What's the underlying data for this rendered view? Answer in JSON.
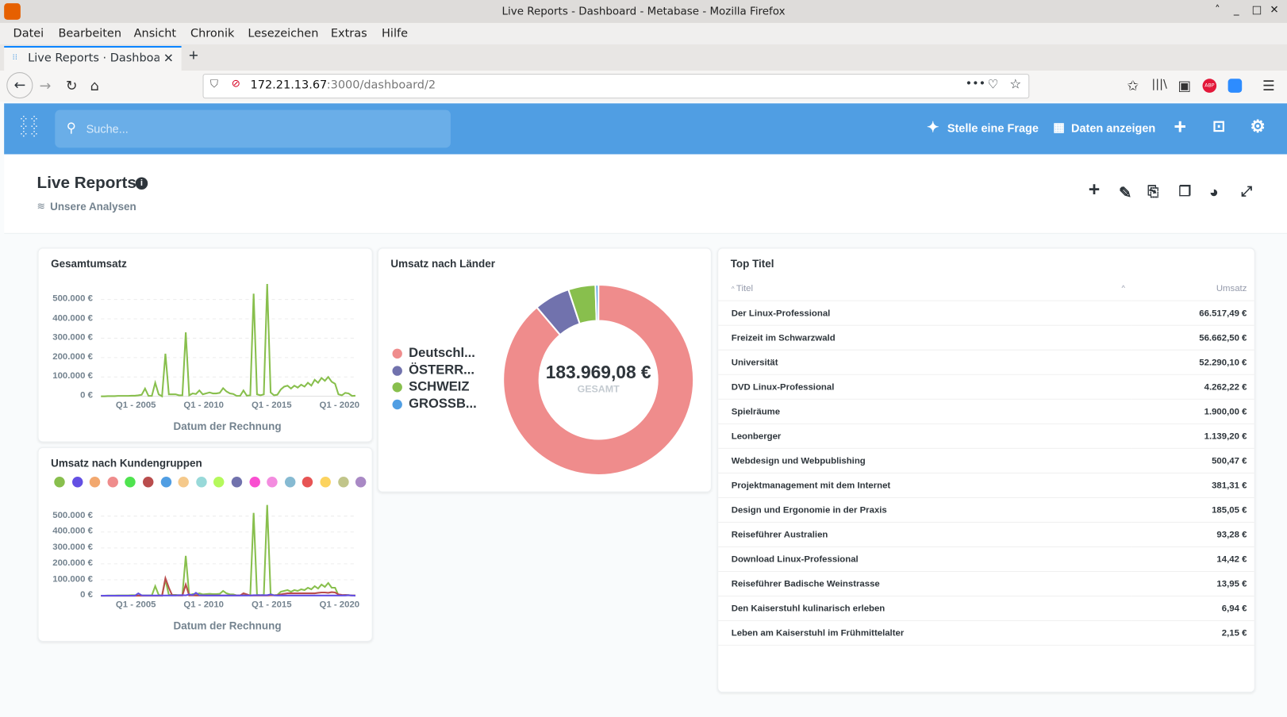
{
  "window": {
    "title": "Live Reports - Dashboard - Metabase - Mozilla Firefox"
  },
  "menu": [
    "Datei",
    "Bearbeiten",
    "Ansicht",
    "Chronik",
    "Lesezeichen",
    "Extras",
    "Hilfe"
  ],
  "tab": {
    "label": "Live Reports · Dashboard"
  },
  "url": {
    "host": "172.21.13.67",
    "path": ":3000/dashboard/2"
  },
  "nav": {
    "search_placeholder": "Suche...",
    "ask": "Stelle eine Frage",
    "browse": "Daten anzeigen",
    "accent": "#509ee3"
  },
  "dashboard": {
    "title": "Live Reports",
    "collection": "Unsere Analysen"
  },
  "chart_data": [
    {
      "type": "line",
      "title": "Gesamtumsatz",
      "xlabel": "Datum der Rechnung",
      "ylabel": "",
      "x_start": "Q1 - 2002",
      "x_end": "Q4 - 2020",
      "x_ticks": [
        "Q1 - 2005",
        "Q1 - 2010",
        "Q1 - 2015",
        "Q1 - 2020"
      ],
      "y_ticks": [
        "500.000 €",
        "400.000 €",
        "300.000 €",
        "200.000 €",
        "100.000 €",
        "0 €"
      ],
      "ylim": [
        0,
        500000
      ],
      "grid": true,
      "series": [
        {
          "color": "#88bf4d",
          "values": [
            0,
            0,
            1000,
            1000,
            1000,
            2000,
            2000,
            2000,
            2000,
            3000,
            3000,
            5000,
            8000,
            40000,
            2000,
            2000,
            70000,
            10000,
            0,
            220000,
            10000,
            10000,
            10000,
            5000,
            5000,
            330000,
            5000,
            15000,
            12000,
            30000,
            10000,
            15000,
            20000,
            15000,
            15000,
            18000,
            42000,
            25000,
            15000,
            12000,
            2000,
            2000,
            30000,
            3000,
            5000,
            530000,
            10000,
            5000,
            10000,
            580000,
            20000,
            5000,
            8000,
            35000,
            50000,
            55000,
            40000,
            55000,
            45000,
            60000,
            50000,
            70000,
            55000,
            85000,
            70000,
            95000,
            80000,
            100000,
            75000,
            65000,
            10000,
            5000,
            18000,
            15000,
            2000,
            3000
          ]
        }
      ]
    },
    {
      "type": "line",
      "title": "Umsatz nach Kundengruppen",
      "xlabel": "Datum der Rechnung",
      "ylabel": "",
      "x_ticks": [
        "Q1 - 2005",
        "Q1 - 2010",
        "Q1 - 2015",
        "Q1 - 2020"
      ],
      "y_ticks": [
        "500.000 €",
        "400.000 €",
        "300.000 €",
        "200.000 €",
        "100.000 €",
        "0 €"
      ],
      "ylim": [
        0,
        500000
      ],
      "grid": true,
      "legend_colors": [
        "#88bf4d",
        "#6450e3",
        "#f2a86f",
        "#ef8c8c",
        "#4fe34f",
        "#b94d4d",
        "#509ee3",
        "#f5c98b",
        "#98d9d9",
        "#b5f95c",
        "#7172ad",
        "#f94fd0",
        "#f38cdf",
        "#86bad2",
        "#e75454",
        "#fcd35f",
        "#c1c58a",
        "#a989c5"
      ],
      "series": [
        {
          "color": "#88bf4d",
          "values": [
            0,
            0,
            1000,
            1000,
            1000,
            2000,
            2000,
            2000,
            2000,
            3000,
            3000,
            2000,
            2000,
            2000,
            2000,
            2000,
            60000,
            5000,
            0,
            100000,
            5000,
            5000,
            5000,
            3000,
            3000,
            250000,
            3000,
            10000,
            10000,
            15000,
            8000,
            10000,
            12000,
            10000,
            10000,
            12000,
            30000,
            15000,
            8000,
            8000,
            2000,
            2000,
            3000,
            2000,
            3000,
            520000,
            5000,
            3000,
            5000,
            570000,
            10000,
            3000,
            5000,
            25000,
            30000,
            35000,
            25000,
            35000,
            30000,
            40000,
            35000,
            50000,
            40000,
            60000,
            45000,
            70000,
            55000,
            80000,
            50000,
            50000,
            3000,
            2000,
            5000,
            4000,
            1000,
            1000
          ]
        },
        {
          "color": "#b94d4d",
          "values": [
            0,
            0,
            0,
            0,
            0,
            0,
            0,
            0,
            0,
            0,
            0,
            0,
            0,
            0,
            0,
            0,
            0,
            0,
            0,
            110000,
            50000,
            2000,
            2000,
            1000,
            1000,
            70000,
            1000,
            2000,
            1000,
            1000,
            1000,
            1000,
            1000,
            1000,
            1000,
            1000,
            1000,
            1000,
            1000,
            1000,
            1000,
            1000,
            15000,
            8000,
            1000,
            1000,
            1000,
            1000,
            1000,
            1000,
            2000,
            2000,
            3000,
            8000,
            12000,
            15000,
            15000,
            15000,
            15000,
            15000,
            15000,
            15000,
            15000,
            15000,
            18000,
            20000,
            20000,
            18000,
            22000,
            20000,
            8000,
            5000,
            4000,
            3000,
            1000,
            1000
          ]
        },
        {
          "color": "#6450e3",
          "values": [
            0,
            0,
            0,
            0,
            0,
            0,
            0,
            0,
            0,
            0,
            0,
            15000,
            2000,
            1000,
            1000,
            1000,
            1000,
            1000,
            1000,
            1000,
            1000,
            1000,
            1000,
            3000,
            3000,
            2000,
            8000,
            3000,
            18000,
            3000,
            2000,
            1000,
            1000,
            1000,
            1000,
            1000,
            1000,
            1000,
            1000,
            1000,
            1000,
            1000,
            1000,
            1000,
            1000,
            3000,
            3000,
            3000,
            3000,
            3000,
            8000,
            2000,
            1000,
            1000,
            1000,
            1000,
            1000,
            1000,
            1000,
            1000,
            1000,
            1000,
            1000,
            1000,
            1000,
            1000,
            1000,
            1000,
            1000,
            1000,
            1000,
            1000,
            1000,
            3000,
            1000,
            0
          ]
        }
      ]
    },
    {
      "type": "pie",
      "title": "Umsatz nach Länder",
      "total": "183.969,08 €",
      "total_label": "GESAMT",
      "slices": [
        {
          "label": "Deutschl...",
          "share": 0.888,
          "color": "#ef8c8c"
        },
        {
          "label": "ÖSTERR...",
          "share": 0.061,
          "color": "#7172ad"
        },
        {
          "label": "SCHWEIZ",
          "share": 0.046,
          "color": "#88bf4d"
        },
        {
          "label": "GROSSB...",
          "share": 0.005,
          "color": "#509ee3"
        }
      ]
    },
    {
      "type": "table",
      "title": "Top Titel",
      "columns": [
        "Titel",
        "Umsatz"
      ],
      "rows": [
        [
          "Der Linux-Professional",
          "66.517,49 €"
        ],
        [
          "Freizeit im Schwarzwald",
          "56.662,50 €"
        ],
        [
          "Universität",
          "52.290,10 €"
        ],
        [
          "DVD Linux-Professional",
          "4.262,22 €"
        ],
        [
          "Spielräume",
          "1.900,00 €"
        ],
        [
          "Leonberger",
          "1.139,20 €"
        ],
        [
          "Webdesign und Webpublishing",
          "500,47 €"
        ],
        [
          "Projektmanagement mit dem Internet",
          "381,31 €"
        ],
        [
          "Design und Ergonomie in der Praxis",
          "185,05 €"
        ],
        [
          "Reiseführer Australien",
          "93,28 €"
        ],
        [
          "Download Linux-Professional",
          "14,42 €"
        ],
        [
          "Reiseführer Badische Weinstrasse",
          "13,95 €"
        ],
        [
          "Den Kaiserstuhl kulinarisch erleben",
          "6,94 €"
        ],
        [
          "Leben am Kaiserstuhl im Frühmittelalter",
          "2,15 €"
        ]
      ]
    }
  ]
}
